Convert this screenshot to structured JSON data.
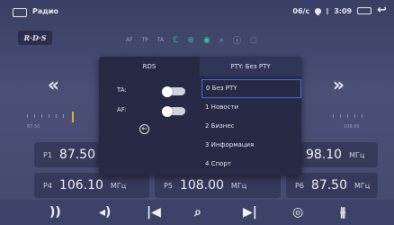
{
  "status_bar": {
    "app_title": "Радио",
    "date": "06/с",
    "time": "3:09"
  },
  "header": {
    "rds_logo": "R·D·S",
    "flags": [
      "AF",
      "TP",
      "TA"
    ]
  },
  "scale": {
    "min_label": "87.50",
    "max_label": "108.00"
  },
  "presets": [
    {
      "pn": "P1",
      "freq": "87.50",
      "unit": "МГц"
    },
    {
      "pn": "P3",
      "freq": "98.10",
      "unit": "МГц"
    },
    {
      "pn": "P4",
      "freq": "106.10",
      "unit": "МГц"
    },
    {
      "pn": "P5",
      "freq": "108.00",
      "unit": "МГц"
    },
    {
      "pn": "P6",
      "freq": "87.50",
      "unit": "МГц"
    }
  ],
  "dialog": {
    "tab_rds": "RDS",
    "tab_pty": "PTY: Без PTY",
    "ta_label": "TA:",
    "af_label": "AF:",
    "pty_items": [
      "0 Без PTY",
      "1 Новости",
      "2 Бизнес",
      "3 Информация",
      "4 Спорт"
    ],
    "selected_index": 0
  },
  "icons": {
    "status": [
      "window-icon",
      "location-icon",
      "signal-icon",
      "battery-icon",
      "back-icon"
    ],
    "toolbar": [
      "rds-icon",
      "af-icon",
      "search-icon",
      "info-icon",
      "scan-icon"
    ],
    "bottom": [
      "radio-wave-icon",
      "speaker-icon",
      "seek-prev-icon",
      "search-icon",
      "seek-next-icon",
      "podcast-icon",
      "equalizer-icon"
    ]
  },
  "colors": {
    "accent_green": "#2ec99b",
    "needle_orange": "#f2a33a",
    "selection_blue": "#4a6ad8"
  }
}
